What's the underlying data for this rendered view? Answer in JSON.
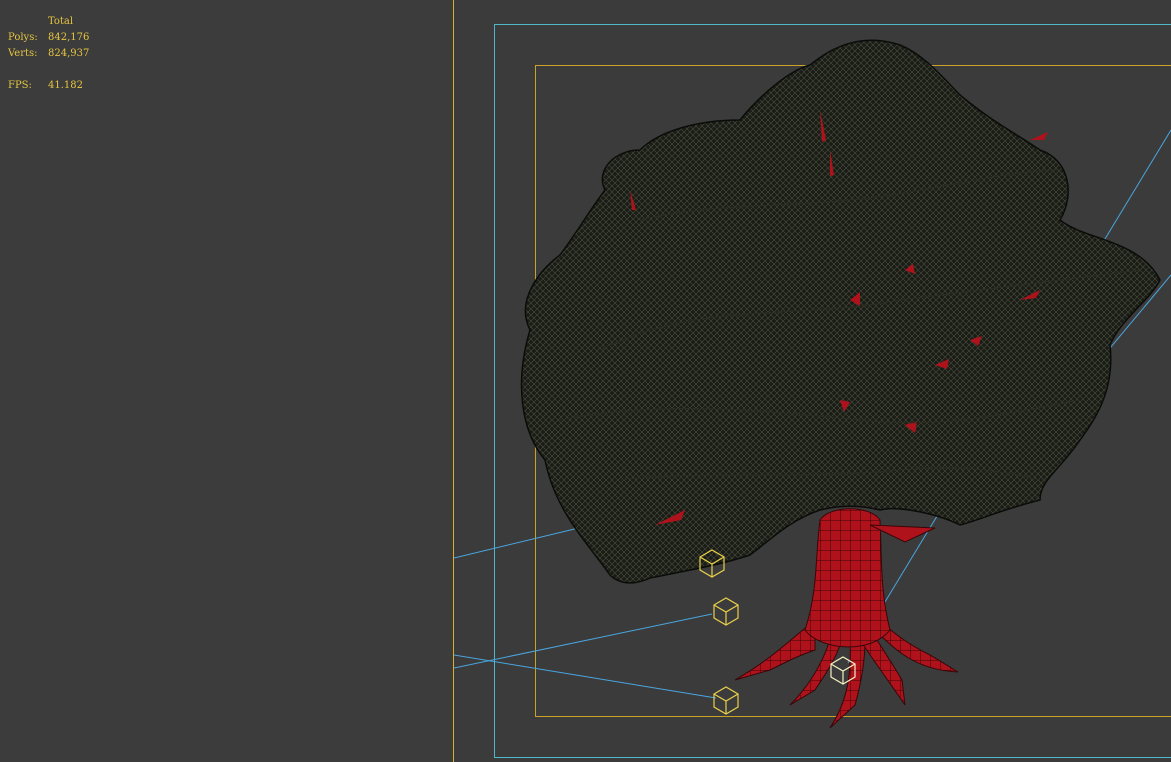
{
  "stats": {
    "header": "Total",
    "polys_label": "Polys:",
    "polys_value": "842,176",
    "verts_label": "Verts:",
    "verts_value": "824,937",
    "fps_label": "FPS:",
    "fps_value": "41.182"
  },
  "colors": {
    "background": "#3b3b3b",
    "stats_text": "#e5c540",
    "safe_frame_outer": "#4fb7c9",
    "safe_frame_inner": "#c9a227",
    "camera_line": "#4aa6e0",
    "gizmo": "#e8d04a",
    "trunk": "#b0121c",
    "foliage": "#141612"
  },
  "icons": {
    "gizmo": "cube-gizmo-icon"
  }
}
